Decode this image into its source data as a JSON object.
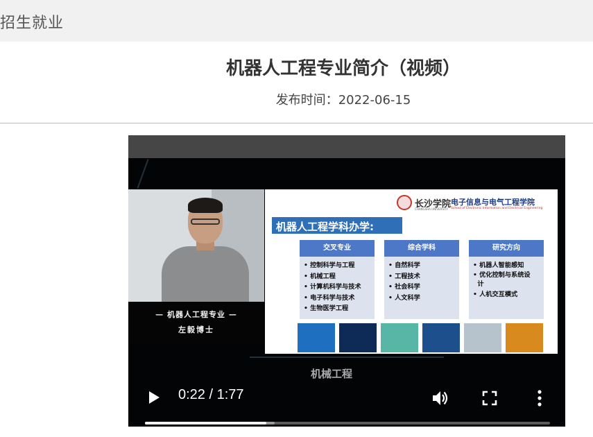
{
  "breadcrumb": {
    "label": "招生就业"
  },
  "article": {
    "title": "机器人工程专业简介（视频）",
    "date_label": "发布时间：",
    "date_value": "2022-06-15"
  },
  "video": {
    "presenter_caption_title": "— 机器人工程专业 —",
    "presenter_caption_name": "左毅博士",
    "slide": {
      "university_logo": "长沙学院",
      "university_logo_en": "CHANGSHA UNIVERSITY",
      "college_name": "电子信息与电气工程学院",
      "college_name_en": "School of Electronic Information and Electrical Engineering",
      "banner": "机器人工程学科办学:",
      "columns": [
        {
          "heading": "交叉专业",
          "items": [
            "• 控制科学与工程",
            "• 机械工程",
            "• 计算机科学与技术",
            "• 电子科学与技术",
            "• 生物医学工程"
          ]
        },
        {
          "heading": "综合学科",
          "items": [
            "• 自然科学",
            "• 工程技术",
            "• 社会科学",
            "• 人文科学"
          ]
        },
        {
          "heading": "研究方向",
          "items": [
            "• 机器人智能感知",
            "• 优化控制与系统设",
            "  计",
            "• 人机交互模式"
          ]
        }
      ],
      "thumbnails": [
        "5g-network",
        "connected-earth",
        "recycling-cycle",
        "microchip",
        "optics-lens",
        "industrial-robot-arm"
      ]
    },
    "subtitle": "机械工程",
    "controls": {
      "time": "0:22 / 1:77",
      "play_icon": "play-icon",
      "volume_icon": "volume-icon",
      "fullscreen_icon": "fullscreen-icon",
      "more_icon": "more-vert-icon",
      "progress_fraction": 0.3,
      "buffered_fraction": 0.32
    }
  },
  "colors": {
    "breadcrumb_bg": "#f1f1f1",
    "slide_banner": "#2e6fb7",
    "column_head": "#4d78c8"
  }
}
